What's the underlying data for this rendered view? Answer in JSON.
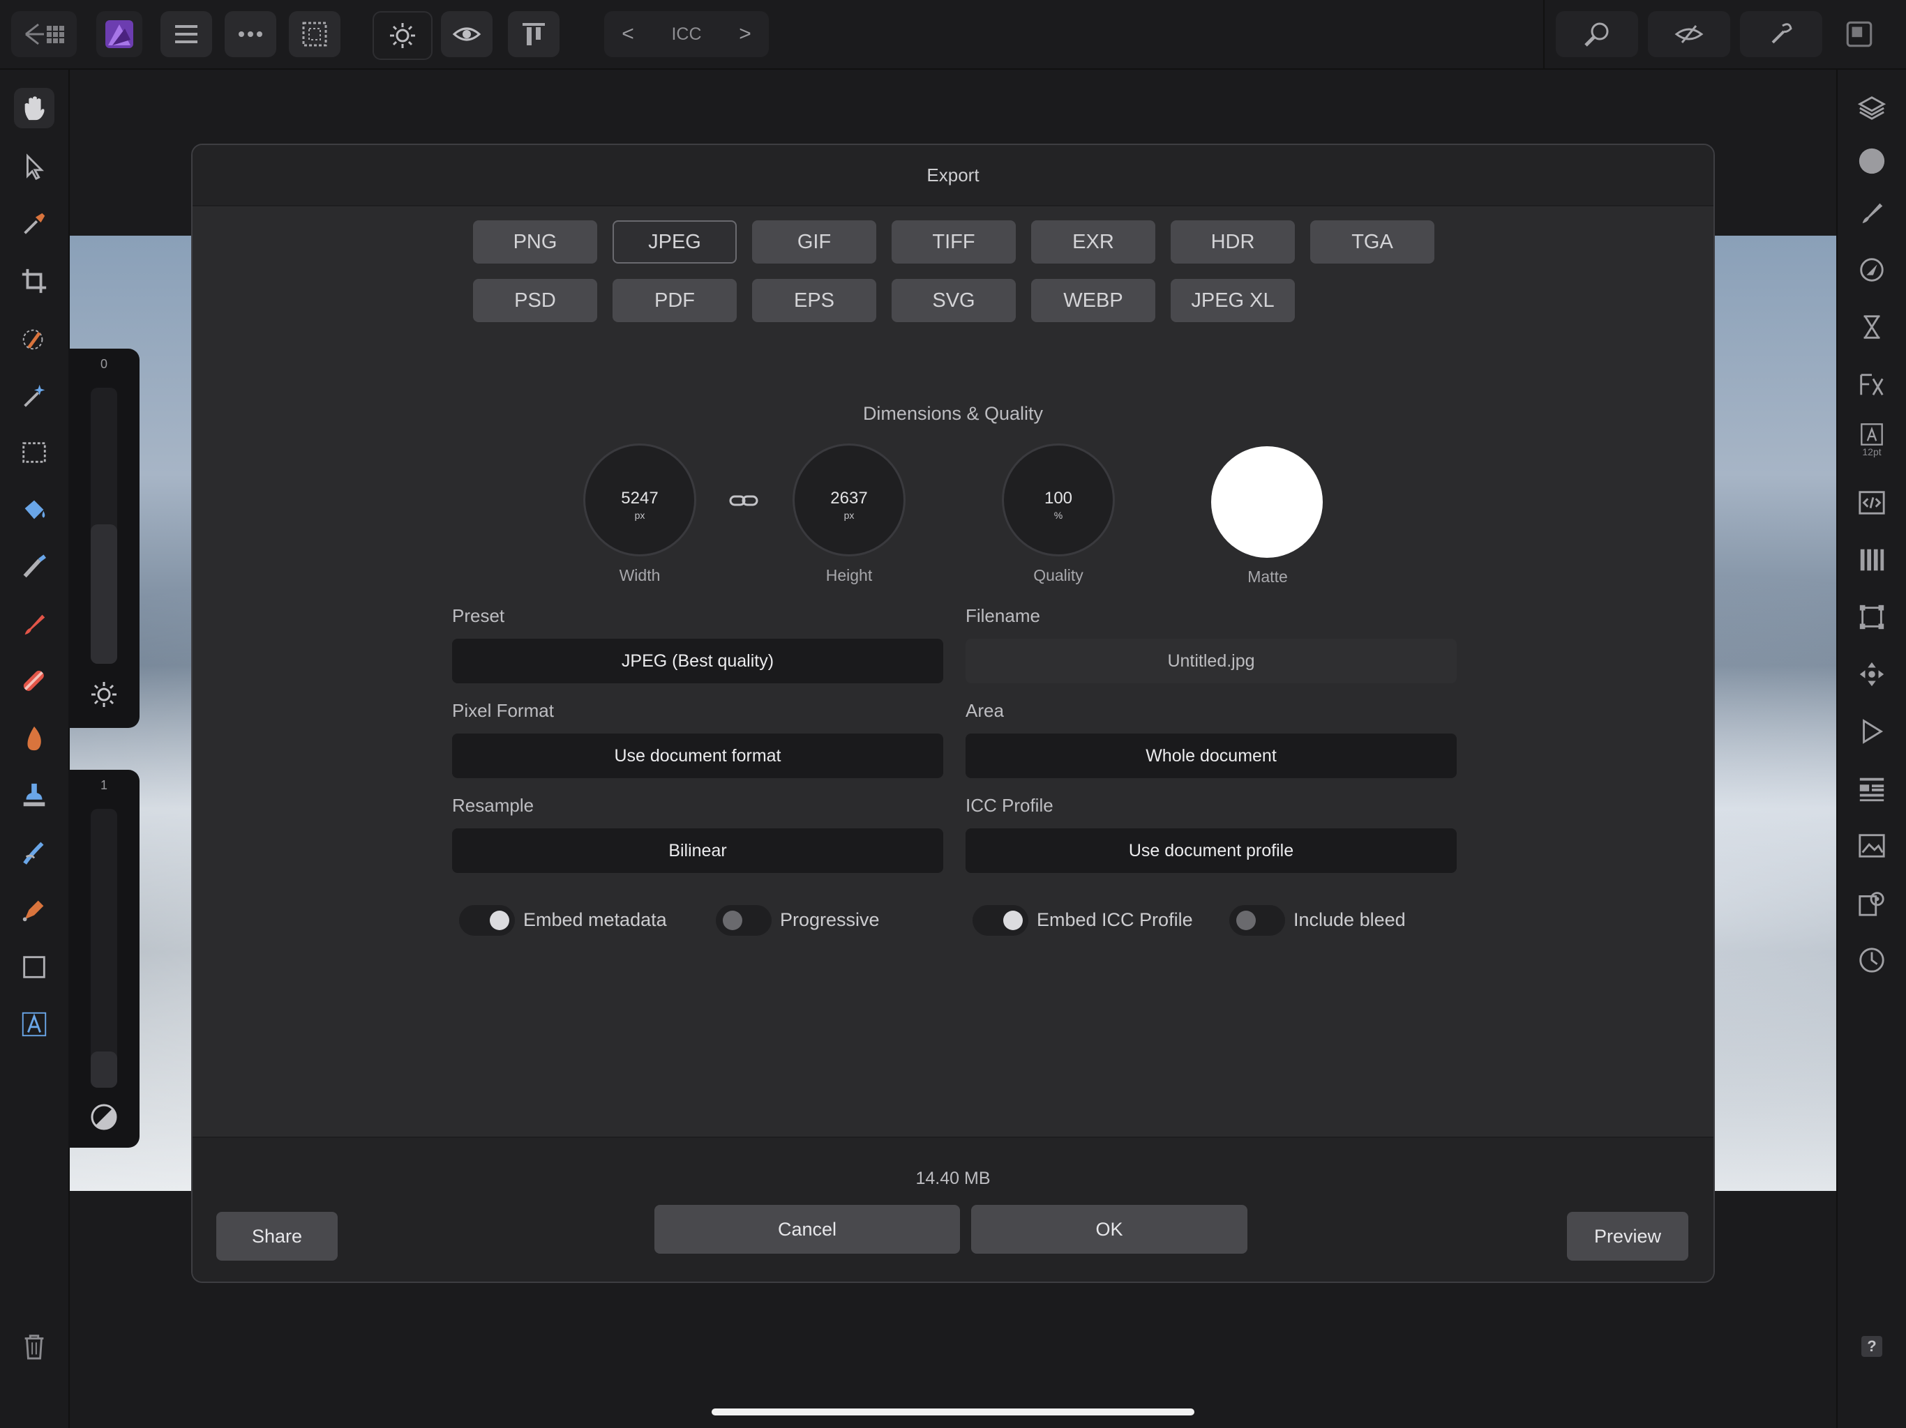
{
  "app": {
    "accent": "#8b55c9",
    "toolbar_icons": [
      "back-arrow-icon",
      "grid-icon",
      "affinity-photo-logo",
      "menu-icon",
      "more-icon",
      "selection-icon",
      "brightness-icon",
      "eye-icon",
      "align-icon"
    ],
    "icc_nav": {
      "label": "ICC",
      "prev": "<",
      "next": ">"
    },
    "right_icons": [
      "zoom-icon",
      "view-mode-icon",
      "assistant-icon"
    ]
  },
  "left_tools": [
    "hand-icon",
    "pointer-icon",
    "eyedropper-icon",
    "crop-icon",
    "brush-select-icon",
    "magic-wand-icon",
    "marquee-icon",
    "flood-fill-icon",
    "paint-mixer-icon",
    "paint-brush-icon",
    "healing-brush-icon",
    "burn-icon",
    "clone-stamp-icon",
    "smudge-icon",
    "pen-icon",
    "rectangle-icon",
    "text-icon",
    "trash-icon"
  ],
  "left_sliders": {
    "top": {
      "value": "0"
    },
    "bottom": {
      "value": "1"
    }
  },
  "right_panel": {
    "icons": [
      "layers-icon",
      "color-icon",
      "brushes-icon",
      "adjustments-icon",
      "hourglass-icon",
      "fx-icon",
      "character-icon",
      "html-icon",
      "channels-icon",
      "transform-icon",
      "navigator-icon",
      "play-icon",
      "library-icon",
      "stock-icon",
      "settings-icon",
      "history-icon",
      "help-icon"
    ],
    "character_size": "12pt",
    "help_label": "?"
  },
  "dialog": {
    "title": "Export",
    "formats_row1": [
      "PNG",
      "JPEG",
      "GIF",
      "TIFF",
      "EXR",
      "HDR",
      "TGA"
    ],
    "formats_row2": [
      "PSD",
      "PDF",
      "EPS",
      "SVG",
      "WEBP",
      "JPEG XL"
    ],
    "selected_format": "JPEG",
    "section_title": "Dimensions & Quality",
    "width": {
      "value": "5247",
      "unit": "px",
      "label": "Width"
    },
    "height": {
      "value": "2637",
      "unit": "px",
      "label": "Height"
    },
    "quality": {
      "value": "100",
      "unit": "%",
      "label": "Quality"
    },
    "matte": {
      "label": "Matte",
      "color": "#ffffff"
    },
    "preset": {
      "label": "Preset",
      "value": "JPEG (Best quality)"
    },
    "filename": {
      "label": "Filename",
      "value": "Untitled.jpg"
    },
    "pixel_format": {
      "label": "Pixel Format",
      "value": "Use document format"
    },
    "area": {
      "label": "Area",
      "value": "Whole document"
    },
    "resample": {
      "label": "Resample",
      "value": "Bilinear"
    },
    "icc_profile": {
      "label": "ICC Profile",
      "value": "Use document profile"
    },
    "toggles": [
      {
        "label": "Embed metadata",
        "on": true
      },
      {
        "label": "Progressive",
        "on": false
      },
      {
        "label": "Embed ICC Profile",
        "on": true
      },
      {
        "label": "Include bleed",
        "on": false
      }
    ],
    "file_size": "14.40 MB",
    "buttons": {
      "share": "Share",
      "cancel": "Cancel",
      "ok": "OK",
      "preview": "Preview"
    }
  }
}
